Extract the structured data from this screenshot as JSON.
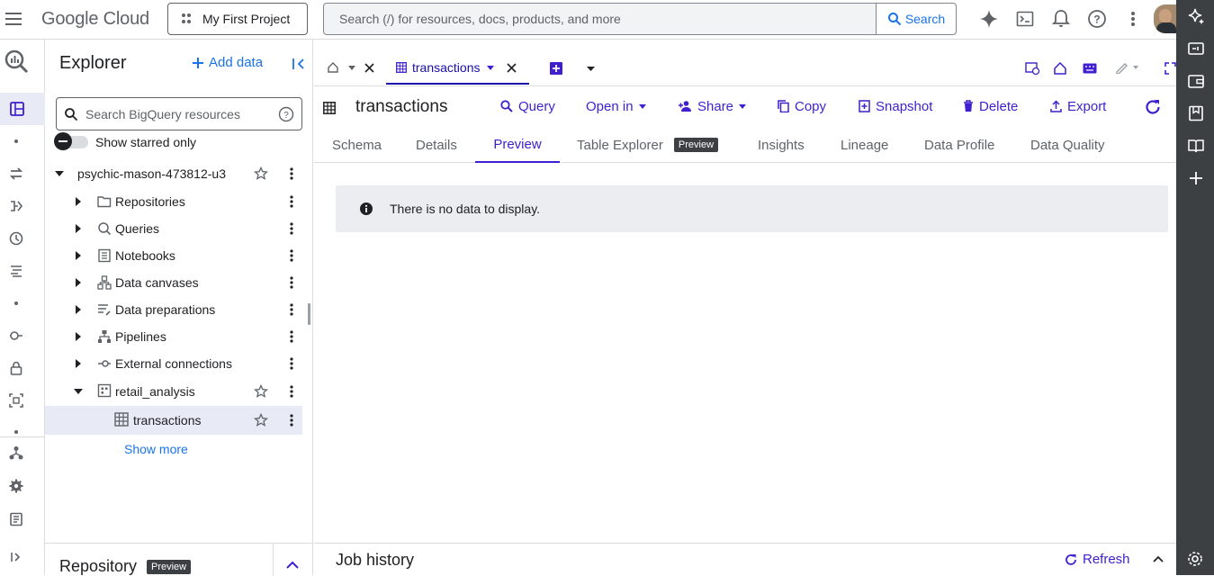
{
  "topbar": {
    "logo_google": "Google",
    "logo_cloud": "Cloud",
    "project": "My First Project",
    "search_placeholder": "Search (/) for resources, docs, products, and more",
    "search_button": "Search"
  },
  "explorer": {
    "title": "Explorer",
    "add_data": "Add data",
    "search_placeholder": "Search BigQuery resources",
    "show_starred": "Show starred only",
    "project": "psychic-mason-473812-u3",
    "items": [
      {
        "label": "Repositories",
        "icon": "repository-icon"
      },
      {
        "label": "Queries",
        "icon": "query-icon"
      },
      {
        "label": "Notebooks",
        "icon": "notebook-icon"
      },
      {
        "label": "Data canvases",
        "icon": "canvas-icon"
      },
      {
        "label": "Data preparations",
        "icon": "data-prep-icon"
      },
      {
        "label": "Pipelines",
        "icon": "pipeline-icon"
      },
      {
        "label": "External connections",
        "icon": "connection-icon"
      }
    ],
    "dataset": "retail_analysis",
    "table": "transactions",
    "show_more": "Show more"
  },
  "repository": {
    "title": "Repository",
    "badge": "Preview"
  },
  "tabs": {
    "active_label": "transactions"
  },
  "toolbar": {
    "title": "transactions",
    "query": "Query",
    "open_in": "Open in",
    "share": "Share",
    "copy": "Copy",
    "snapshot": "Snapshot",
    "delete": "Delete",
    "export": "Export"
  },
  "subtabs": {
    "schema": "Schema",
    "details": "Details",
    "preview": "Preview",
    "table_explorer": "Table Explorer",
    "table_explorer_badge": "Preview",
    "insights": "Insights",
    "lineage": "Lineage",
    "data_profile": "Data Profile",
    "data_quality": "Data Quality"
  },
  "message": "There is no data to display.",
  "job_history": {
    "title": "Job history",
    "refresh": "Refresh"
  },
  "colors": {
    "accent": "#3f1fce",
    "link": "#1a73e8",
    "rail": "#3c4043"
  }
}
